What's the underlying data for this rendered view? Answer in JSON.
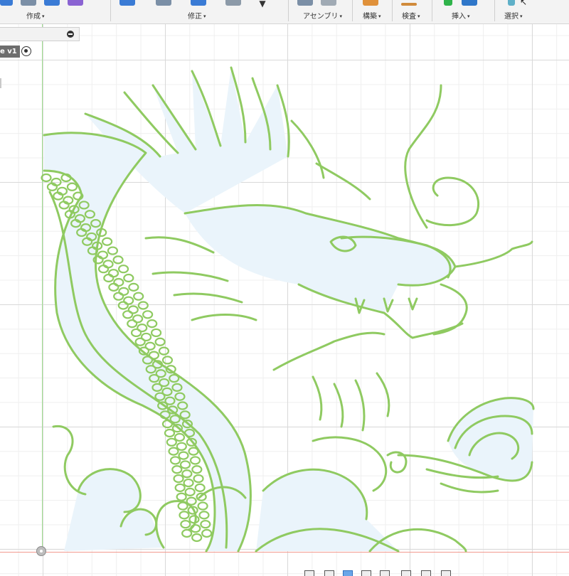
{
  "toolbar": {
    "groups": [
      {
        "label": "作成"
      },
      {
        "label": "修正"
      },
      {
        "label": "アセンブリ"
      },
      {
        "label": "構築"
      },
      {
        "label": "検査"
      },
      {
        "label": "挿入"
      },
      {
        "label": "選択"
      }
    ],
    "caret": "▾"
  },
  "browser": {
    "sketch_label": "e v1"
  },
  "colors": {
    "outline": "#8fca61",
    "fill": "#eaf4fb",
    "grid_major": "#d9d9d9",
    "grid_minor": "#efefef",
    "y_axis": "#9fdf8f",
    "x_axis": "#f29a8f"
  },
  "icons": [
    "create-box-icon",
    "modify-icon",
    "assembly-icon",
    "construct-icon",
    "inspect-icon",
    "insert-icon",
    "select-cursor-icon",
    "browser-collapse-icon",
    "visibility-radio-icon",
    "origin-icon"
  ]
}
